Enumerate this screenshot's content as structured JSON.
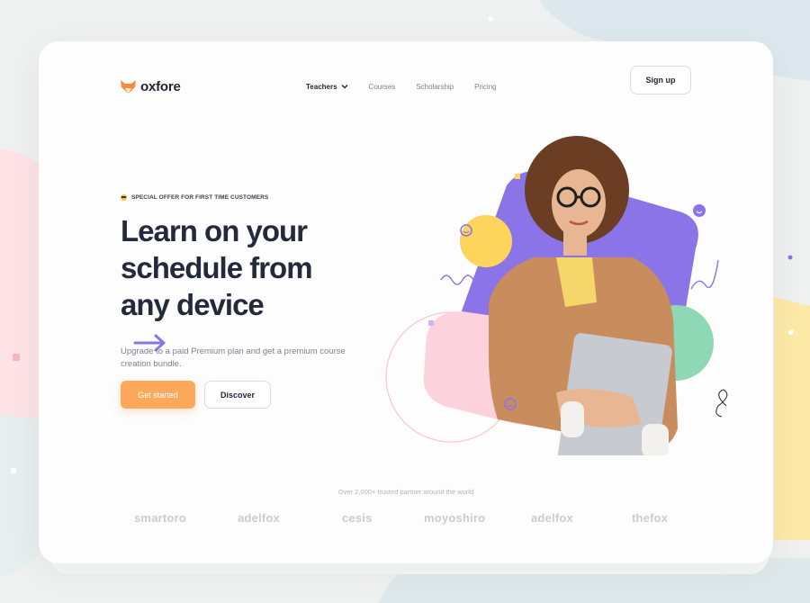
{
  "brand": {
    "name": "oxfore"
  },
  "nav": {
    "items": [
      {
        "label": "Teachers",
        "active": true
      },
      {
        "label": "Courses"
      },
      {
        "label": "Scholarship"
      },
      {
        "label": "Pricing"
      }
    ],
    "signup_label": "Sign up"
  },
  "hero": {
    "offer": "SPECIAL OFFER FOR FIRST TIME CUSTOMERS",
    "headline": [
      "Learn on your",
      "schedule from",
      "any device"
    ],
    "subtext": "Upgrade to a paid Premium plan and get a premium course creation bundle.",
    "cta_primary": "Get started",
    "cta_secondary": "Discover"
  },
  "partners": {
    "caption": "Over 2,000+ trusted partner around the world",
    "logos": [
      "smartoro",
      "adelfox",
      "cesis",
      "moyoshiro",
      "adelfox",
      "thefox"
    ]
  },
  "colors": {
    "accent_orange": "#fda95b",
    "purple": "#8b74e8",
    "yellow": "#fdd45c",
    "pink": "#fcd3dc",
    "green": "#8fd8b5",
    "text_dark": "#242a3b"
  },
  "icons": [
    "fox-logo-icon",
    "chevron-down-icon",
    "arrow-right-icon",
    "sunglasses-emoji-icon"
  ]
}
